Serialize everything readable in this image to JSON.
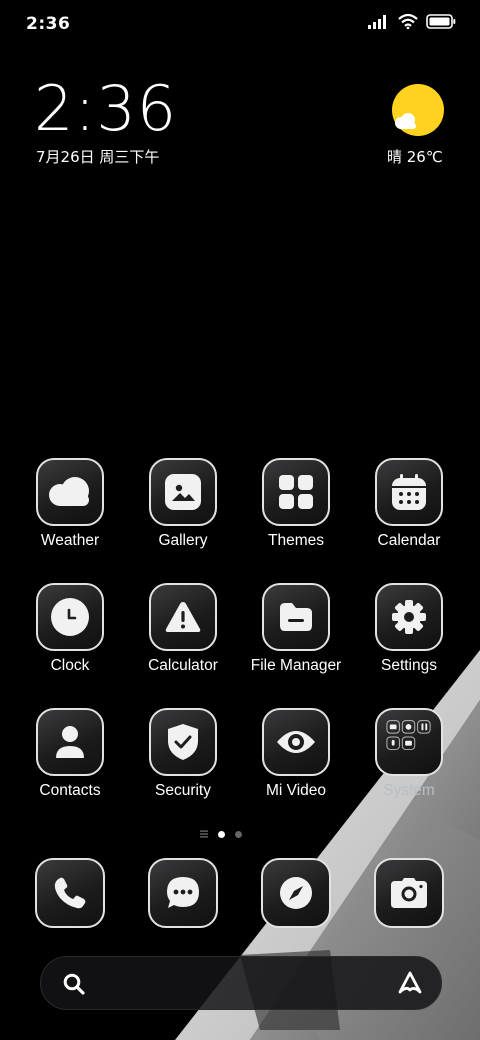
{
  "status_bar": {
    "time": "2:36"
  },
  "widget": {
    "clock": "2:36",
    "date": "7月26日 周三下午",
    "weather": "晴 26℃"
  },
  "apps": [
    {
      "label": "Weather"
    },
    {
      "label": "Gallery"
    },
    {
      "label": "Themes"
    },
    {
      "label": "Calendar"
    },
    {
      "label": "Clock"
    },
    {
      "label": "Calculator"
    },
    {
      "label": "File Manager"
    },
    {
      "label": "Settings"
    },
    {
      "label": "Contacts"
    },
    {
      "label": "Security"
    },
    {
      "label": "Mi Video"
    },
    {
      "label": "System"
    }
  ],
  "dock": [
    "phone-icon",
    "messages-icon",
    "browser-icon",
    "camera-icon"
  ],
  "page_indicator": {
    "pages": 2,
    "current": 1
  },
  "colors": {
    "sun": "#ffd21f",
    "icon_border": "#e2e2e2",
    "background": "#000000"
  }
}
